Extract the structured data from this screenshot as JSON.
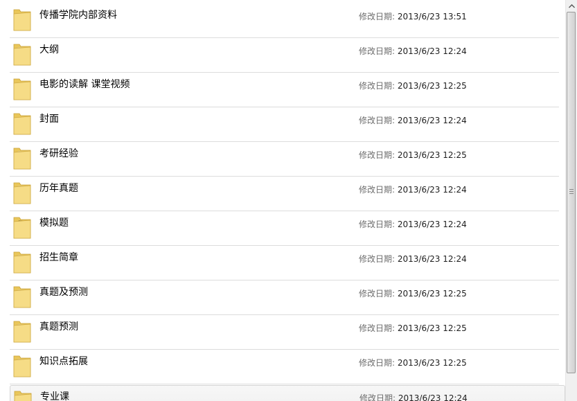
{
  "file_list": {
    "date_label": "修改日期:",
    "items": [
      {
        "name": "传播学院内部资料",
        "modified": "2013/6/23 13:51",
        "icon": "folder-icon"
      },
      {
        "name": "大纲",
        "modified": "2013/6/23 12:24",
        "icon": "folder-docs-icon"
      },
      {
        "name": "电影的读解 课堂视频",
        "modified": "2013/6/23 12:25",
        "icon": "folder-media-icon"
      },
      {
        "name": "封面",
        "modified": "2013/6/23 12:24",
        "icon": "folder-image-icon"
      },
      {
        "name": "考研经验",
        "modified": "2013/6/23 12:25",
        "icon": "folder-docs-icon"
      },
      {
        "name": "历年真题",
        "modified": "2013/6/23 12:24",
        "icon": "folder-docs-icon"
      },
      {
        "name": "模拟题",
        "modified": "2013/6/23 12:24",
        "icon": "folder-dark-icon"
      },
      {
        "name": "招生简章",
        "modified": "2013/6/23 12:24",
        "icon": "folder-docs-icon"
      },
      {
        "name": "真题及预测",
        "modified": "2013/6/23 12:25",
        "icon": "folder-docs-icon"
      },
      {
        "name": "真题预测",
        "modified": "2013/6/23 12:25",
        "icon": "folder-docs-icon"
      },
      {
        "name": "知识点拓展",
        "modified": "2013/6/23 12:25",
        "icon": "folder-docs-icon"
      },
      {
        "name": "专业课",
        "modified": "2013/6/23 12:24",
        "icon": "folder-docs-icon",
        "selected": true
      }
    ]
  },
  "scrollbar": {
    "up_icon": "scroll-up-arrow-icon",
    "grip_icon": "scroll-grip-icon"
  },
  "colors": {
    "folder_yellow": "#f3d77a",
    "folder_dark": "#d9b64e",
    "label_gray": "#6d6d6d",
    "separator": "#dcdcdc"
  }
}
